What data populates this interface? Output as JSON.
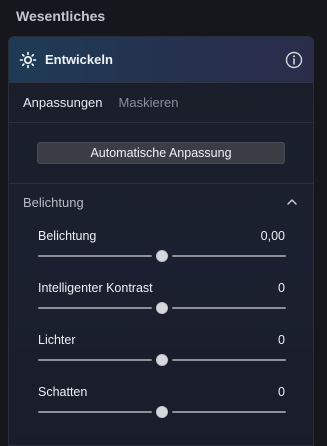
{
  "section_title": "Wesentliches",
  "panel": {
    "title": "Entwickeln",
    "icon": "sun-icon",
    "info_icon": "info-icon"
  },
  "tabs": [
    {
      "label": "Anpassungen",
      "active": true
    },
    {
      "label": "Maskieren",
      "active": false
    }
  ],
  "auto_button": "Automatische Anpassung",
  "group": {
    "title": "Belichtung",
    "expanded": true,
    "sliders": [
      {
        "label": "Belichtung",
        "value": "0,00",
        "level": 0.5
      },
      {
        "label": "Intelligenter Kontrast",
        "value": "0",
        "level": 0.5
      },
      {
        "label": "Lichter",
        "value": "0",
        "level": 0.5
      },
      {
        "label": "Schatten",
        "value": "0",
        "level": 0.5
      }
    ]
  },
  "colors": {
    "background": "#15171d",
    "header_gradient_start": "#1e3b56",
    "header_gradient_end": "#2a2d4a",
    "button": "#3a3d44",
    "track": "#8d9098",
    "thumb": "#d6d8dd"
  }
}
